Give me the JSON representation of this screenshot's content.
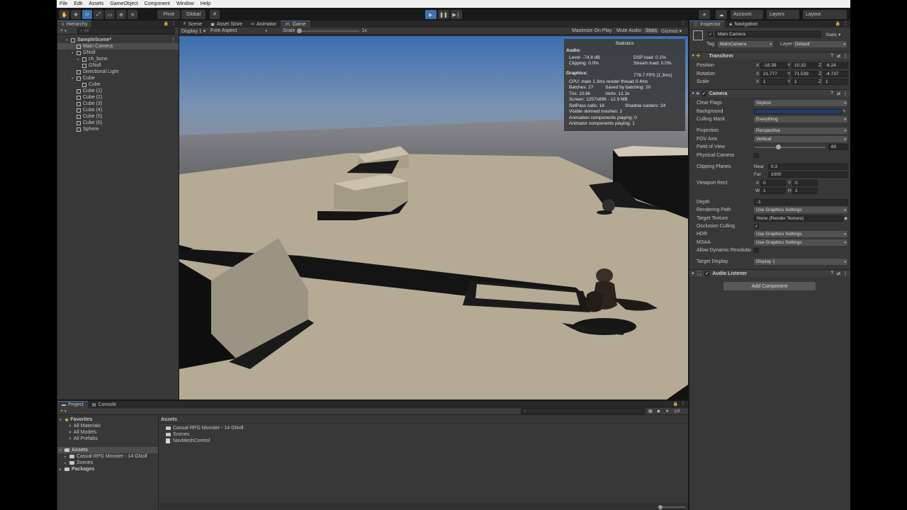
{
  "menu": [
    "File",
    "Edit",
    "Assets",
    "GameObject",
    "Component",
    "Window",
    "Help"
  ],
  "toolbar": {
    "pivot_label": "Pivot",
    "global_label": "Global",
    "account_label": "Account",
    "layers_label": "Layers",
    "layout_label": "Layout"
  },
  "hierarchy": {
    "tab_label": "Hierarchy",
    "search_placeholder": "All",
    "items": [
      {
        "label": "SampleScene*",
        "indent": 0
      },
      {
        "label": "Main Camera",
        "indent": 1
      },
      {
        "label": "GNoll",
        "indent": 1
      },
      {
        "label": "ch_bone",
        "indent": 2
      },
      {
        "label": "GNoll",
        "indent": 2
      },
      {
        "label": "Directional Light",
        "indent": 1
      },
      {
        "label": "Cube",
        "indent": 1
      },
      {
        "label": "Cube",
        "indent": 2
      },
      {
        "label": "Cube (1)",
        "indent": 1
      },
      {
        "label": "Cube (2)",
        "indent": 1
      },
      {
        "label": "Cube (3)",
        "indent": 1
      },
      {
        "label": "Cube (4)",
        "indent": 1
      },
      {
        "label": "Cube (5)",
        "indent": 1
      },
      {
        "label": "Cube (6)",
        "indent": 1
      },
      {
        "label": "Sphere",
        "indent": 1
      }
    ]
  },
  "center_tabs": {
    "scene": "Scene",
    "asset_store": "Asset Store",
    "animator": "Animator",
    "game": "Game"
  },
  "game_bar": {
    "display": "Display 1",
    "aspect": "Free Aspect",
    "scale_label": "Scale",
    "scale_value": "1x",
    "maximize": "Maximize On Play",
    "mute": "Mute Audio",
    "stats": "Stats",
    "gizmos": "Gizmos"
  },
  "stats": {
    "title": "Statistics",
    "audio_heading": "Audio:",
    "level": "Level: -74.8 dB",
    "dsp": "DSP load: 0.1%",
    "clipping": "Clipping: 0.0%",
    "stream": "Stream load: 0.0%",
    "graphics_heading": "Graphics:",
    "fps": "778.7 FPS (1.3ms)",
    "cpu": "CPU: main 1.3ms  render thread 0.4ms",
    "batches": "Batches: 27",
    "saved": "Saved by batching: 20",
    "tris": "Tris: 10.6k",
    "verts": "Verts: 12.1k",
    "screen": "Screen: 1257x899 - 12.9 MB",
    "setpass": "SetPass calls: 16",
    "shadow": "Shadow casters: 24",
    "skinned": "Visible skinned meshes: 1",
    "anim": "Animation components playing: 0",
    "animator": "Animator components playing: 1"
  },
  "inspector": {
    "tab_label": "Inspector",
    "nav_tab": "Navigation",
    "object_name": "Main Camera",
    "static_label": "Static",
    "tag_label": "Tag",
    "tag_value": "MainCamera",
    "layer_label": "Layer",
    "layer_value": "Default",
    "transform": {
      "title": "Transform",
      "position_label": "Position",
      "rotation_label": "Rotation",
      "scale_label": "Scale",
      "position": [
        "-18.39",
        "10.32",
        "-6.24"
      ],
      "rotation": [
        "21.777",
        "71.539",
        "-4.737"
      ],
      "scale": [
        "1",
        "1",
        "1"
      ]
    },
    "camera": {
      "title": "Camera",
      "clear_flags_label": "Clear Flags",
      "clear_flags": "Skybox",
      "background_label": "Background",
      "background_color": "#1f3f6e",
      "culling_label": "Culling Mask",
      "culling": "Everything",
      "projection_label": "Projection",
      "projection": "Perspective",
      "fov_axis_label": "FOV Axis",
      "fov_axis": "Vertical",
      "fov_label": "Field of View",
      "fov": "60",
      "fov_fraction": 0.33,
      "physical_label": "Physical Camera",
      "clipping_label": "Clipping Planes",
      "near_label": "Near",
      "near": "0.3",
      "far_label": "Far",
      "far": "1000",
      "viewport_label": "Viewport Rect",
      "vx": "0",
      "vy": "0",
      "vw": "1",
      "vh": "1",
      "depth_label": "Depth",
      "depth": "-1",
      "rendering_label": "Rendering Path",
      "rendering": "Use Graphics Settings",
      "target_tex_label": "Target Texture",
      "target_tex": "None (Render Texture)",
      "occlusion_label": "Occlusion Culling",
      "hdr_label": "HDR",
      "hdr": "Use Graphics Settings",
      "msaa_label": "MSAA",
      "msaa": "Use Graphics Settings",
      "dyn_res_label": "Allow Dynamic Resolutio",
      "target_display_label": "Target Display",
      "target_display": "Display 1"
    },
    "audio_listener": "Audio Listener",
    "add_component": "Add Component"
  },
  "project": {
    "tab_label": "Project",
    "console_tab": "Console",
    "favorites": "Favorites",
    "fav_items": [
      "All Materials",
      "All Models",
      "All Prefabs"
    ],
    "assets": "Assets",
    "asset_tree": [
      "Casual RPG Monster - 14 GNoll",
      "Scenes"
    ],
    "packages": "Packages",
    "breadcrumb": "Assets",
    "files": [
      "Casual RPG Monster - 14 GNoll",
      "Scenes",
      "NavMeshControl"
    ],
    "badge": "9"
  }
}
